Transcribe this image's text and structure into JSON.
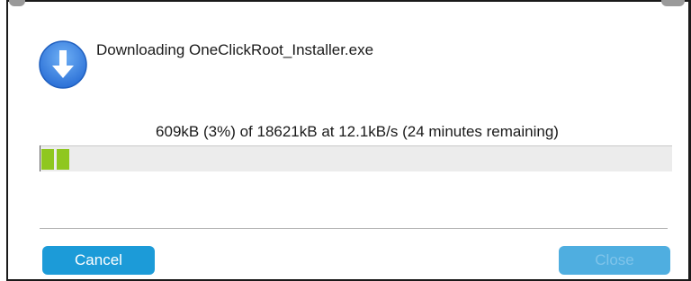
{
  "dialog": {
    "title": "Downloading OneClickRoot_Installer.exe",
    "status": "609kB (3%) of 18621kB at 12.1kB/s (24 minutes remaining)",
    "progress_fraction": 0.03,
    "icon": "download-arrow-icon",
    "accent_color": "#1c9bd8",
    "progress_color": "#8fc71f"
  },
  "buttons": {
    "cancel_label": "Cancel",
    "close_label": "Close"
  }
}
